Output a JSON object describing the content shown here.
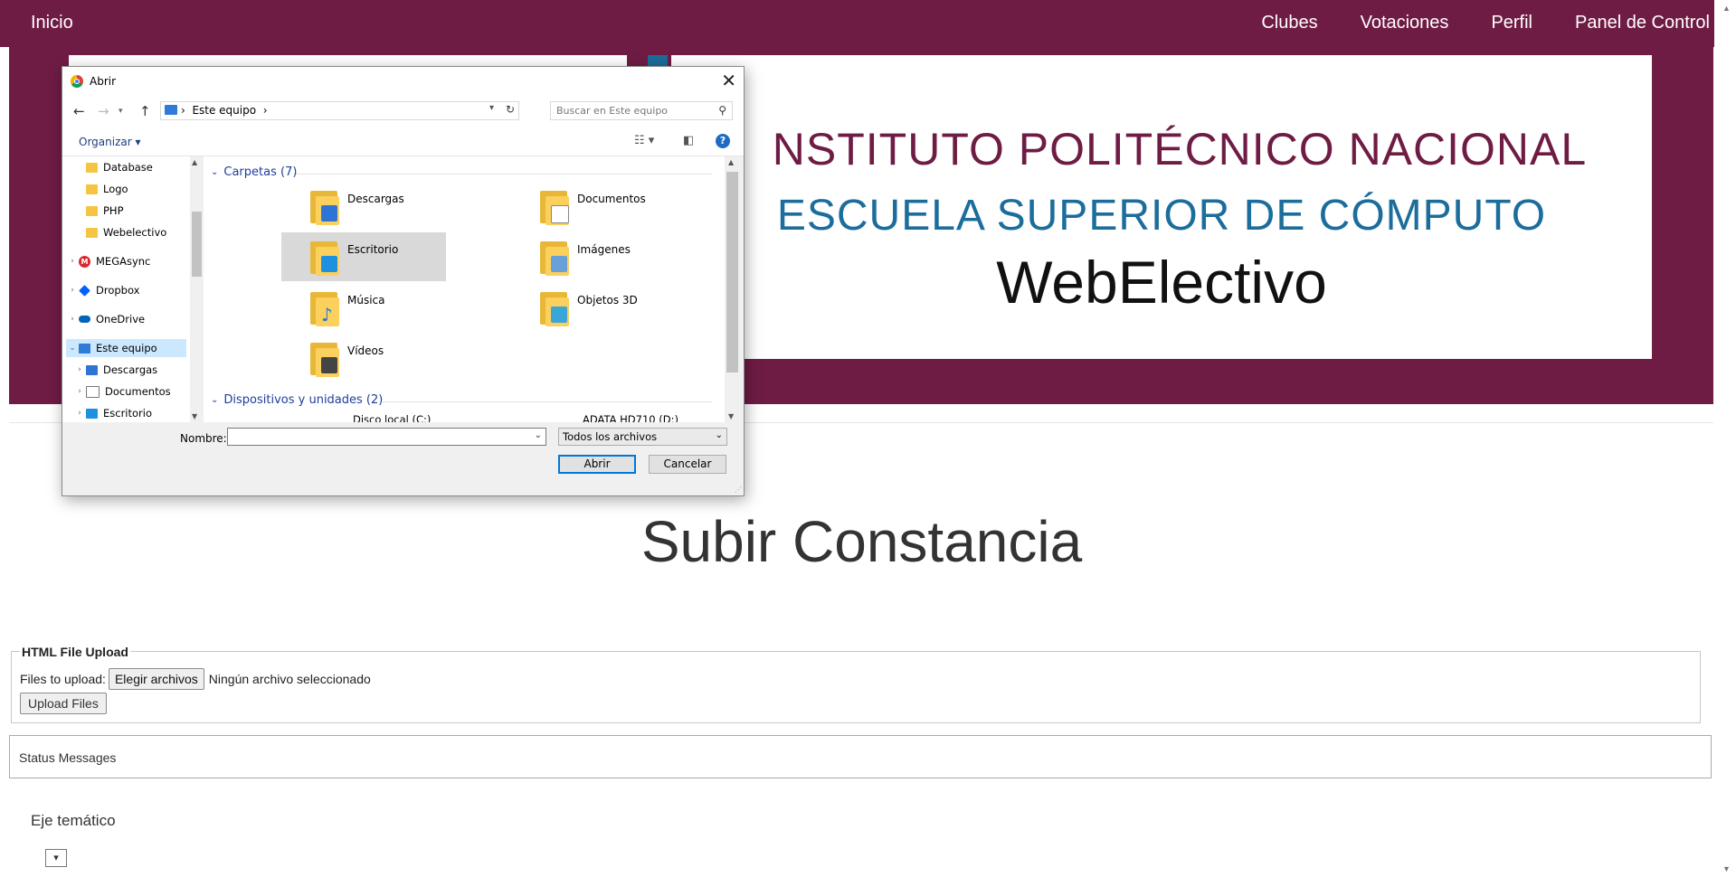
{
  "nav": {
    "home": "Inicio",
    "items": [
      "Clubes",
      "Votaciones",
      "Perfil",
      "Panel de Control"
    ]
  },
  "banner": {
    "line1": "NSTITUTO POLITÉCNICO NACIONAL",
    "line2": "ESCUELA SUPERIOR DE CÓMPUTO",
    "line3": "WebElectivo"
  },
  "page": {
    "title": "Subir Constancia",
    "upload": {
      "legend": "HTML File Upload",
      "files_label": "Files to upload:",
      "choose_button": "Elegir archivos",
      "no_file": "Ningún archivo seleccionado",
      "upload_button": "Upload Files"
    },
    "status": "Status Messages",
    "eje_label": "Eje temático",
    "eje_select": "▾"
  },
  "dialog": {
    "title": "Abrir",
    "close": "✕",
    "address": "Este equipo",
    "search_placeholder": "Buscar en Este equipo",
    "organize": "Organizar",
    "tree": [
      {
        "label": "Database",
        "icon": "folder-icon"
      },
      {
        "label": "Logo",
        "icon": "folder-icon"
      },
      {
        "label": "PHP",
        "icon": "folder-icon"
      },
      {
        "label": "Webelectivo",
        "icon": "folder-icon"
      },
      {
        "label": "MEGAsync",
        "icon": "mega-icon"
      },
      {
        "label": "Dropbox",
        "icon": "dropbox-icon"
      },
      {
        "label": "OneDrive",
        "icon": "onedrive-icon"
      },
      {
        "label": "Este equipo",
        "icon": "computer-icon",
        "selected": true
      },
      {
        "label": "Descargas",
        "icon": "downloads-icon"
      },
      {
        "label": "Documentos",
        "icon": "documents-icon"
      },
      {
        "label": "Escritorio",
        "icon": "desktop-icon"
      }
    ],
    "groups": {
      "folders": "Carpetas (7)",
      "devices": "Dispositivos y unidades (2)"
    },
    "folders": [
      {
        "label": "Descargas",
        "badge": "#2d74d6"
      },
      {
        "label": "Documentos",
        "badge": "#ffffff"
      },
      {
        "label": "Escritorio",
        "badge": "#1e90e0",
        "selected": true
      },
      {
        "label": "Imágenes",
        "badge": "#6aa0d8"
      },
      {
        "label": "Música",
        "badge": "#1e7ad8"
      },
      {
        "label": "Objetos 3D",
        "badge": "#3aa6d8"
      },
      {
        "label": "Vídeos",
        "badge": "#444444"
      }
    ],
    "devices": [
      "Disco local (C:)",
      "ADATA HD710 (D:)"
    ],
    "filename_label": "Nombre:",
    "filename_value": "",
    "filter": "Todos los archivos",
    "open_button": "Abrir",
    "cancel_button": "Cancelar"
  },
  "colors": {
    "brand": "#6f1c44",
    "secondary": "#1b6d9c"
  }
}
